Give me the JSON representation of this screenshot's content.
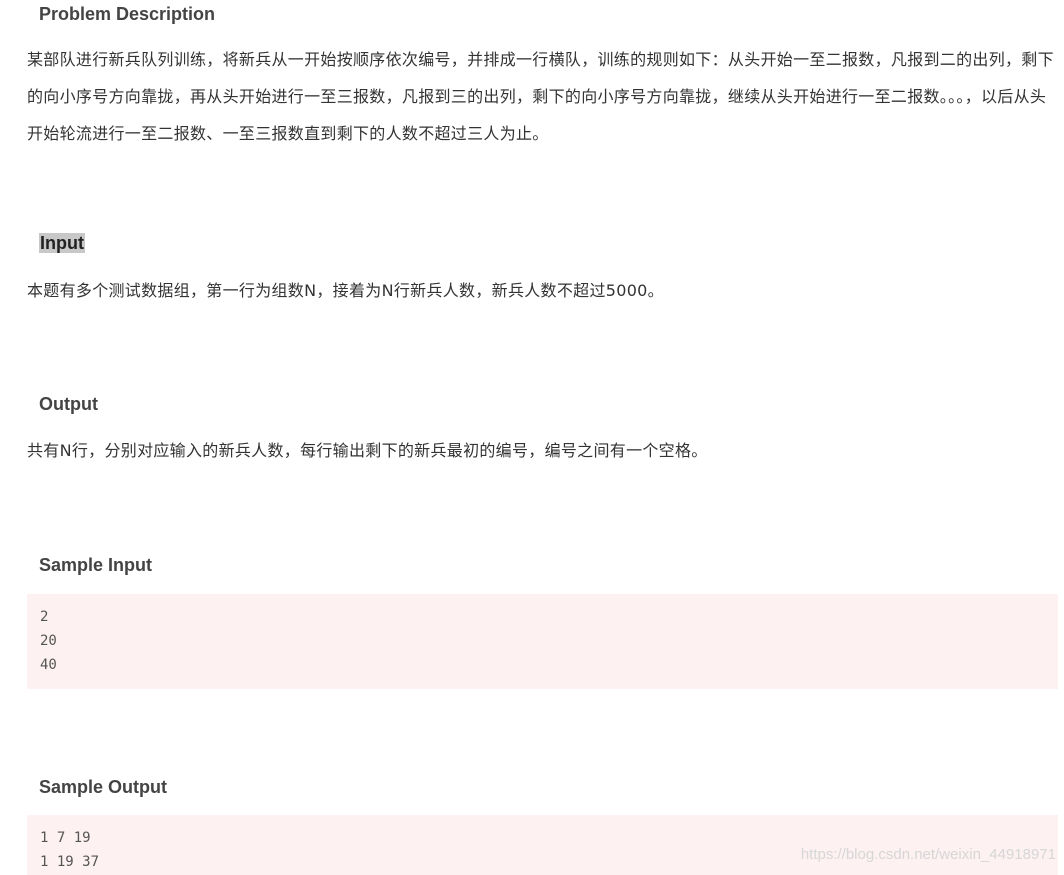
{
  "problem": {
    "title": "Problem Description",
    "text": "某部队进行新兵队列训练，将新兵从一开始按顺序依次编号，并排成一行横队，训练的规则如下：从头开始一至二报数，凡报到二的出列，剩下的向小序号方向靠拢，再从头开始进行一至三报数，凡报到三的出列，剩下的向小序号方向靠拢，继续从头开始进行一至二报数。。。，以后从头开始轮流进行一至二报数、一至三报数直到剩下的人数不超过三人为止。"
  },
  "input": {
    "title": "Input",
    "text": "本题有多个测试数据组，第一行为组数N，接着为N行新兵人数，新兵人数不超过5000。"
  },
  "output": {
    "title": "Output",
    "text": "共有N行，分别对应输入的新兵人数，每行输出剩下的新兵最初的编号，编号之间有一个空格。"
  },
  "sample_input": {
    "title": "Sample Input",
    "lines": [
      "2",
      "20",
      "40"
    ]
  },
  "sample_output": {
    "title": "Sample Output",
    "lines": [
      "1 7 19",
      "1 19 37"
    ]
  },
  "watermark": "https://blog.csdn.net/weixin_44918971",
  "colors": {
    "code_background": "#fdf1f2",
    "highlight": "#c8c8c8"
  }
}
